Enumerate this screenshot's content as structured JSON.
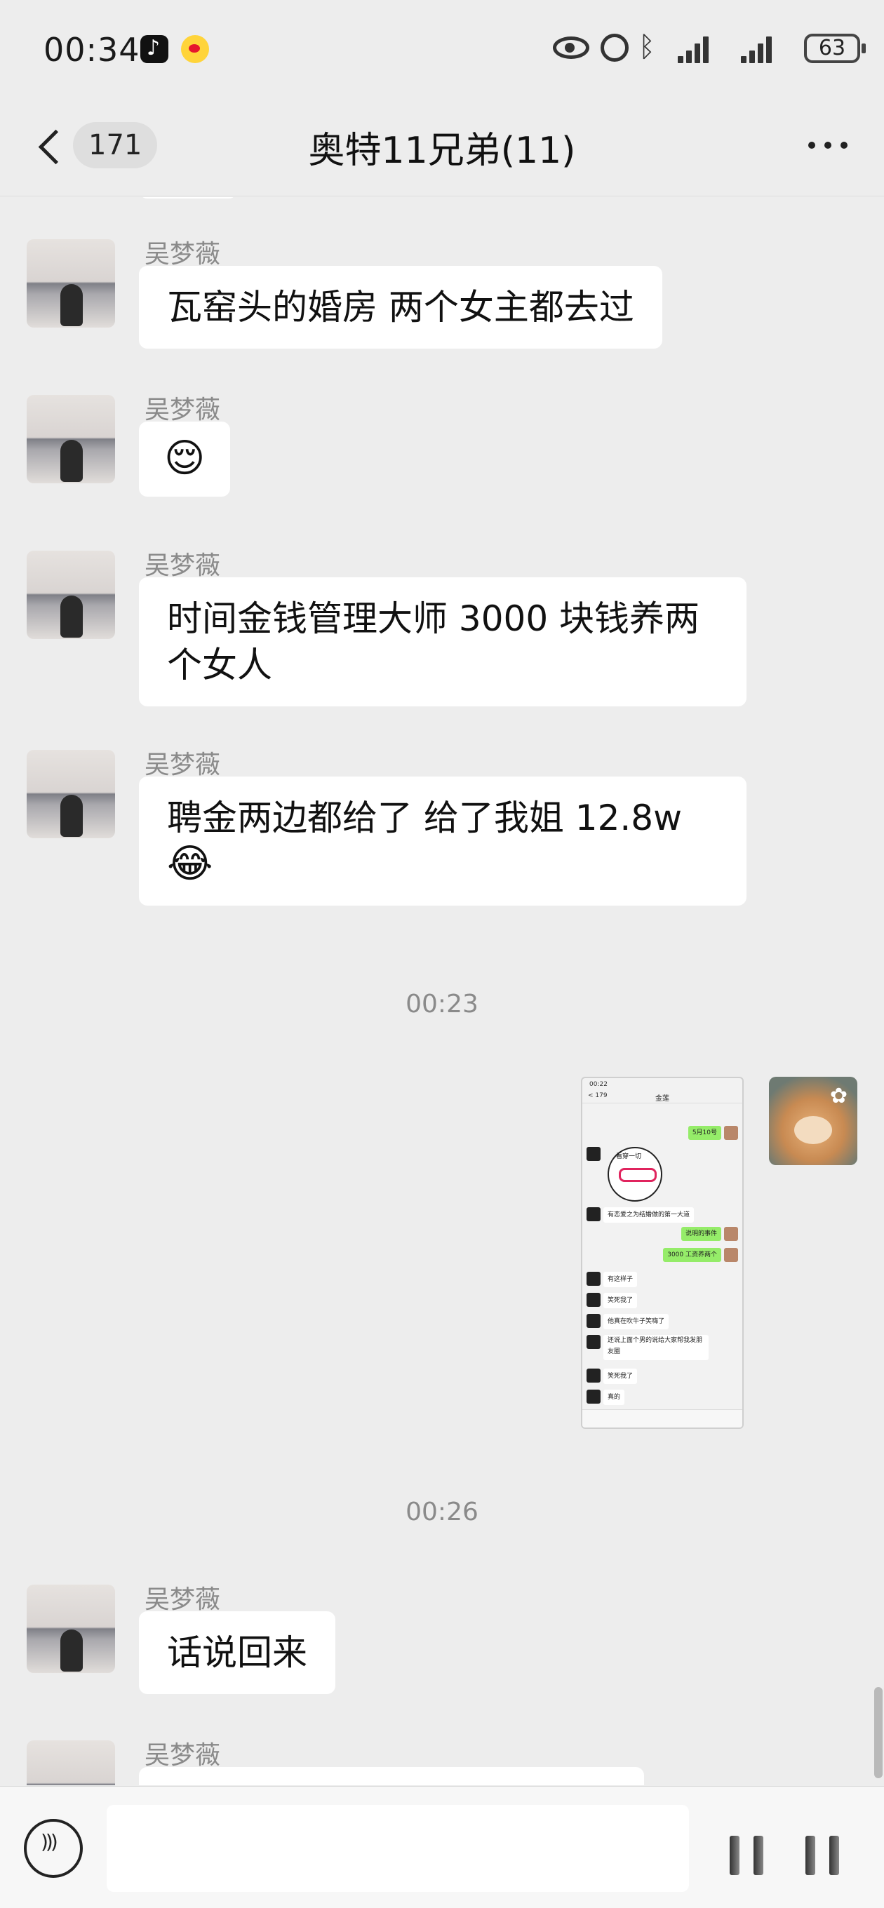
{
  "status_bar": {
    "time": "00:34",
    "battery": "63",
    "icons": [
      "tiktok-icon",
      "weibo-icon",
      "eye-icon",
      "alarm-icon",
      "bluetooth-icon",
      "signal-icon",
      "signal-icon",
      "battery-icon"
    ]
  },
  "header": {
    "unread_count": "171",
    "title": "奥特11兄弟(11)"
  },
  "messages": [
    {
      "type": "text",
      "sender": "吴梦薇",
      "lines": [
        "瓦窑头的婚房 两个女主都去过"
      ]
    },
    {
      "type": "emoji",
      "sender": "吴梦薇",
      "emoji": "😌"
    },
    {
      "type": "text",
      "sender": "吴梦薇",
      "lines": [
        "时间金钱管理大师 3000 块钱养两",
        "个女人"
      ]
    },
    {
      "type": "text",
      "sender": "吴梦薇",
      "lines": [
        "聘金两边都给了 给了我姐 12.8w",
        "😂"
      ]
    },
    {
      "type": "timestamp",
      "text": "00:23"
    },
    {
      "type": "image",
      "sender": "self",
      "thumbnail": {
        "time": "00:22",
        "back": "< 179",
        "title": "金莲",
        "green_1": "5月10号",
        "sticker_text": "看穿一切",
        "white_1": "有恋爱之为结婚做的第一大道",
        "green_2": "说明的事件",
        "green_3": "3000 工资养两个",
        "white_2": "有这样子",
        "white_3": "笑死我了",
        "white_4": "他真在吹牛子笑嗨了",
        "white_5": "还说上面个男的说给大家帮我发朋友圈",
        "white_6": "笑死我了",
        "white_7": "真的"
      }
    },
    {
      "type": "timestamp",
      "text": "00:26"
    },
    {
      "type": "text",
      "sender": "吴梦薇",
      "lines": [
        "话说回来"
      ]
    },
    {
      "type": "text_partial",
      "sender": "吴梦薇"
    }
  ],
  "input_bar": {
    "voice_icon": "voice-icon",
    "emoji_icon": "emoji-icon",
    "plus_icon": "plus-icon"
  }
}
